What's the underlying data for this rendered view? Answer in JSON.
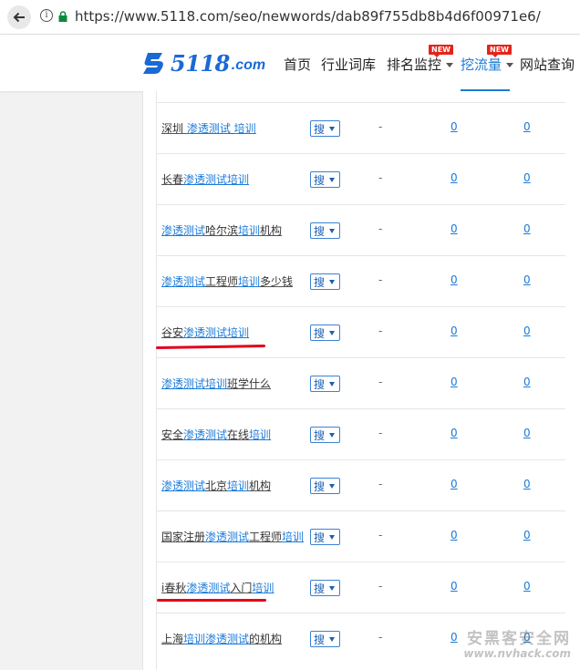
{
  "browser": {
    "url": "https://www.5118.com/seo/newwords/dab89f755db8b4d6f00971e6/"
  },
  "site": {
    "logo_main": "5118",
    "logo_suffix": ".com",
    "nav": [
      {
        "label": "首页"
      },
      {
        "label": "行业词库"
      },
      {
        "label": "排名监控",
        "badge": "NEW"
      },
      {
        "label": "挖流量",
        "badge": "NEW",
        "active": true
      },
      {
        "label": "网站查询"
      }
    ],
    "accent_color": "#1a7ad8",
    "badge_color": "#e3241b"
  },
  "table": {
    "search_button_label": "搜",
    "rows": [
      {
        "pre": "深圳 ",
        "hl": "渗透测试",
        "mid": " ",
        "hl2": "培训",
        "post": "",
        "dash": "-",
        "v1": "0",
        "v2": "0"
      },
      {
        "pre": "长春",
        "hl": "渗透测试培训",
        "mid": "",
        "hl2": "",
        "post": "",
        "dash": "-",
        "v1": "0",
        "v2": "0"
      },
      {
        "pre": "",
        "hl": "渗透测试",
        "mid": "哈尔滨",
        "hl2": "培训",
        "post": "机构",
        "dash": "-",
        "v1": "0",
        "v2": "0"
      },
      {
        "pre": "",
        "hl": "渗透测试",
        "mid": "工程师",
        "hl2": "培训",
        "post": "多少钱",
        "dash": "-",
        "v1": "0",
        "v2": "0"
      },
      {
        "pre": "谷安",
        "hl": "渗透测试培训",
        "mid": "",
        "hl2": "",
        "post": "",
        "dash": "-",
        "v1": "0",
        "v2": "0"
      },
      {
        "pre": "",
        "hl": "渗透测试培训",
        "mid": "",
        "hl2": "",
        "post": "班学什么",
        "dash": "-",
        "v1": "0",
        "v2": "0"
      },
      {
        "pre": "安全",
        "hl": "渗透测试",
        "mid": "在线",
        "hl2": "培训",
        "post": "",
        "dash": "-",
        "v1": "0",
        "v2": "0"
      },
      {
        "pre": "",
        "hl": "渗透测试",
        "mid": "北京",
        "hl2": "培训",
        "post": "机构",
        "dash": "-",
        "v1": "0",
        "v2": "0"
      },
      {
        "pre": "国家注册",
        "hl": "渗透测试",
        "mid": "工程师",
        "hl2": "培训",
        "post": "",
        "dash": "-",
        "v1": "0",
        "v2": "0"
      },
      {
        "pre": "i春秋",
        "hl": "渗透测试",
        "mid": "入门",
        "hl2": "培训",
        "post": "",
        "dash": "-",
        "v1": "0",
        "v2": "0"
      },
      {
        "pre": "上海",
        "hl": "培训",
        "mid": "",
        "hl2": "渗透测试",
        "post": "的机构",
        "dash": "-",
        "v1": "0",
        "v2": "0"
      }
    ]
  },
  "watermark": {
    "line1": "安黑客安全网",
    "line2": "www.nvhack.com"
  }
}
